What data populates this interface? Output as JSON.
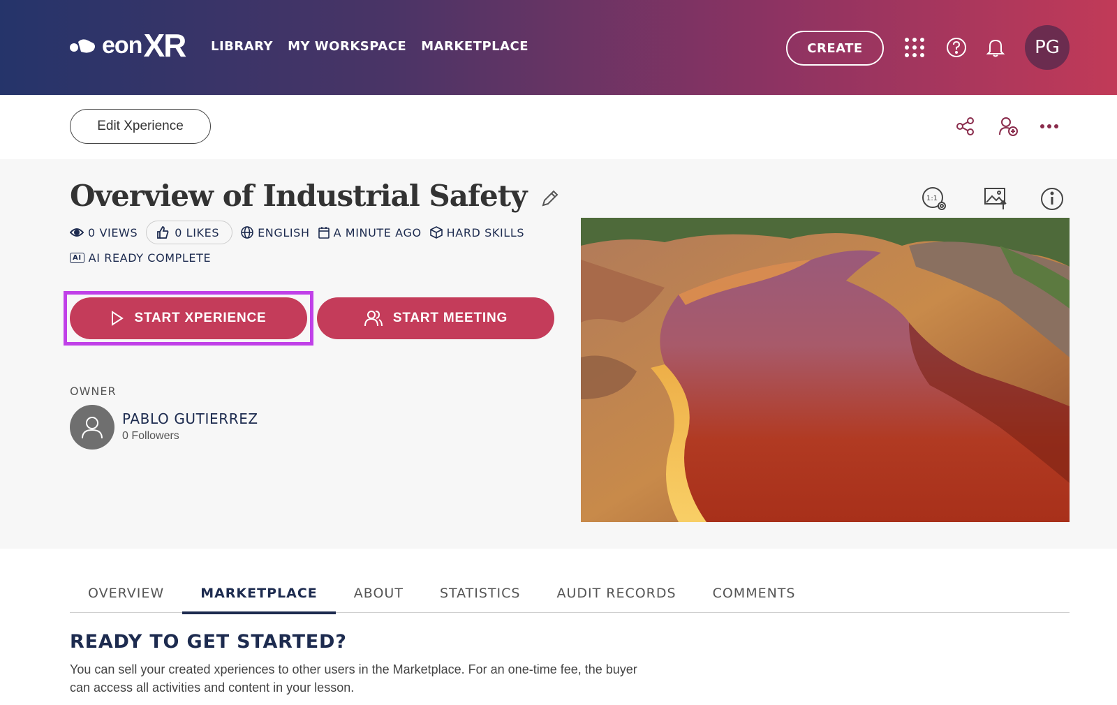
{
  "header": {
    "logo_text_eon": "eon",
    "logo_text_xr": "XR",
    "nav": [
      "LIBRARY",
      "MY WORKSPACE",
      "MARKETPLACE"
    ],
    "create_label": "CREATE",
    "avatar_initials": "PG"
  },
  "toolbar": {
    "edit_label": "Edit Xperience"
  },
  "xperience": {
    "title": "Overview of Industrial Safety",
    "views": "0 VIEWS",
    "likes": "0 LIKES",
    "language": "ENGLISH",
    "updated": "A MINUTE AGO",
    "category": "HARD SKILLS",
    "ai_badge": "AI",
    "ai_status": "AI READY COMPLETE",
    "start_xperience_label": "START XPERIENCE",
    "start_meeting_label": "START MEETING"
  },
  "owner": {
    "label": "OWNER",
    "name": "PABLO GUTIERREZ",
    "followers": "0 Followers"
  },
  "tabs": [
    {
      "label": "OVERVIEW",
      "active": false
    },
    {
      "label": "MARKETPLACE",
      "active": true
    },
    {
      "label": "ABOUT",
      "active": false
    },
    {
      "label": "STATISTICS",
      "active": false
    },
    {
      "label": "AUDIT RECORDS",
      "active": false
    },
    {
      "label": "COMMENTS",
      "active": false
    }
  ],
  "marketplace": {
    "heading": "READY TO GET STARTED?",
    "description": "You can sell your created xperiences to other users in the Marketplace. For an one-time fee, the buyer can access all activities and content in your lesson."
  },
  "colors": {
    "accent": "#c43c5a",
    "navy": "#1d2b4f",
    "highlight": "#c040e8"
  }
}
